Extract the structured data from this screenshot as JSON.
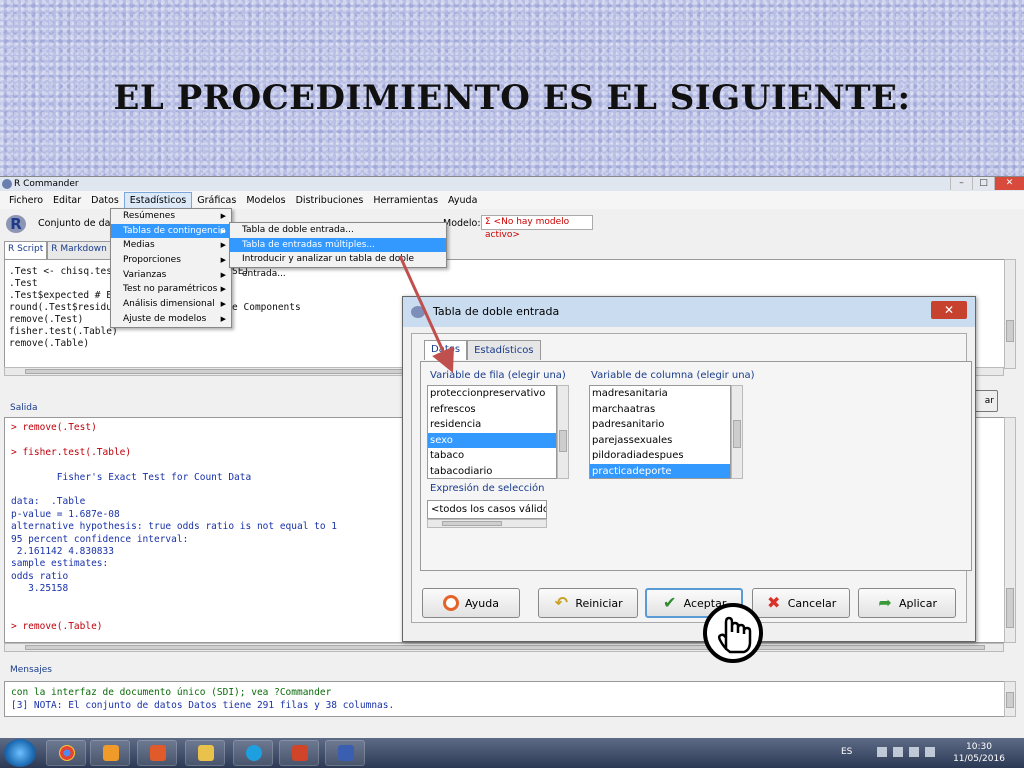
{
  "slide": {
    "title": "EL PROCEDIMIENTO ES EL SIGUIENTE:"
  },
  "window": {
    "title": "R Commander",
    "menu": [
      "Fichero",
      "Editar",
      "Datos",
      "Estadísticos",
      "Gráficas",
      "Modelos",
      "Distribuciones",
      "Herramientas",
      "Ayuda"
    ],
    "active_menu": "Estadísticos"
  },
  "toolbar": {
    "dataset_label": "Conjunto de datos:",
    "model_label": "Modelo:",
    "model_value": "Σ <No hay modelo activo>"
  },
  "tabs": [
    "R Script",
    "R Markdown"
  ],
  "script_lines": [
    ".Test <- chisq.test(.Table, correct=FALSE)",
    ".Test",
    ".Test$expected # Expected Counts",
    "round(.Test$residuals^2, 2) # Chi-square Components",
    "remove(.Test)",
    "fisher.test(.Table)",
    "remove(.Table)"
  ],
  "output": {
    "label": "Salida",
    "execute_button": "Ejecutar",
    "lines": [
      {
        "text": "> remove(.Test)",
        "kind": "cmd"
      },
      {
        "text": "",
        "kind": "res"
      },
      {
        "text": "> fisher.test(.Table)",
        "kind": "cmd"
      },
      {
        "text": "",
        "kind": "res"
      },
      {
        "text": "        Fisher's Exact Test for Count Data",
        "kind": "res"
      },
      {
        "text": "",
        "kind": "res"
      },
      {
        "text": "data:  .Table",
        "kind": "res"
      },
      {
        "text": "p-value = 1.687e-08",
        "kind": "res"
      },
      {
        "text": "alternative hypothesis: true odds ratio is not equal to 1",
        "kind": "res"
      },
      {
        "text": "95 percent confidence interval:",
        "kind": "res"
      },
      {
        "text": " 2.161142 4.830833",
        "kind": "res"
      },
      {
        "text": "sample estimates:",
        "kind": "res"
      },
      {
        "text": "odds ratio",
        "kind": "res"
      },
      {
        "text": "   3.25158",
        "kind": "res"
      },
      {
        "text": "",
        "kind": "res"
      },
      {
        "text": "",
        "kind": "res"
      },
      {
        "text": "> remove(.Table)",
        "kind": "cmd"
      }
    ]
  },
  "messages": {
    "label": "Mensajes",
    "lines": [
      {
        "text": "con la interfaz de documento único (SDI); vea ?Commander",
        "kind": "green"
      },
      {
        "text": "[3] NOTA: El conjunto de datos Datos tiene 291 filas y 38 columnas.",
        "kind": "blue"
      }
    ]
  },
  "menu_estadisticos": [
    {
      "label": "Resúmenes",
      "sub": true
    },
    {
      "label": "Tablas de contingencia",
      "sub": true,
      "highlight": true
    },
    {
      "label": "Medias",
      "sub": true
    },
    {
      "label": "Proporciones",
      "sub": true
    },
    {
      "label": "Varianzas",
      "sub": true
    },
    {
      "label": "Test no paramétricos",
      "sub": true
    },
    {
      "label": "Análisis dimensional",
      "sub": true
    },
    {
      "label": "Ajuste de modelos",
      "sub": true
    }
  ],
  "menu_tablas": [
    {
      "label": "Tabla de doble entrada...",
      "highlight": false
    },
    {
      "label": "Tabla de entradas múltiples...",
      "highlight": true
    },
    {
      "label": "Introducir y analizar un tabla de doble entrada...",
      "highlight": false
    }
  ],
  "dialog": {
    "title": "Tabla de doble entrada",
    "tabs": [
      "Datos",
      "Estadísticos"
    ],
    "row_var_label": "Variable de fila (elegir una)",
    "col_var_label": "Variable de columna (elegir una)",
    "row_vars": [
      "proteccionpreservativo",
      "refrescos",
      "residencia",
      "sexo",
      "tabaco",
      "tabacodiario"
    ],
    "row_selected": "sexo",
    "col_vars": [
      "madresanitaria",
      "marchaatras",
      "padresanitario",
      "parejassexuales",
      "pildoradiadespues",
      "practicadeporte"
    ],
    "col_selected": "practicadeporte",
    "subset_label": "Expresión de selección",
    "subset_value": "<todos los casos válidos>",
    "buttons": {
      "help": "Ayuda",
      "reset": "Reiniciar",
      "ok": "Aceptar",
      "cancel": "Cancelar",
      "apply": "Aplicar"
    }
  },
  "taskbar": {
    "lang": "ES",
    "time": "10:30",
    "date": "11/05/2016"
  },
  "colors": {
    "highlight": "#3399ff",
    "cmd_red": "#c0000a",
    "output_blue": "#1a32a8",
    "message_green": "#0a6a0a"
  }
}
